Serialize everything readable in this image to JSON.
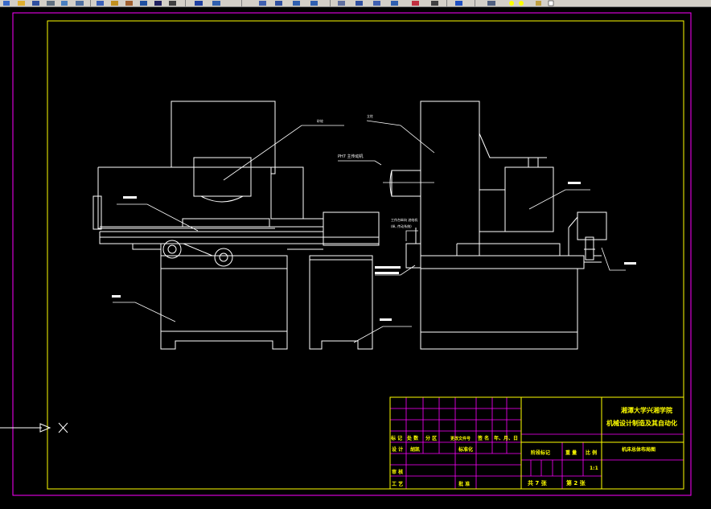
{
  "toolbar": {
    "icons": [
      "new-icon",
      "open-icon",
      "save-icon",
      "print-icon",
      "cut-icon",
      "copy-icon",
      "paste-icon",
      "match-icon",
      "undo-icon",
      "redo-icon",
      "pan-icon",
      "zoom-realtime-icon",
      "zoom-window-icon",
      "zoom-previous-icon",
      "properties-icon",
      "designcenter-icon",
      "toolpalette-icon",
      "sheetset-icon",
      "markup-icon",
      "calculator-icon",
      "help-icon",
      "layer-icon",
      "layer-state-icon"
    ],
    "bulb_color": "#ffff00",
    "layer_color": "#ffffff"
  },
  "drawing": {
    "background": "#000000",
    "frame_color": "#ff00ff",
    "border_color": "#ffff00",
    "line_color": "#ffffff",
    "labels": {
      "grinding_head": "砂轮",
      "column": "立柱",
      "ph7": "PH7 主传动机",
      "worktable_feed": "工作台纵向 进给机",
      "worktable_feed_line2": "(纵, 传动系统)"
    }
  },
  "title_block": {
    "school_line1": "湘潭大学兴湘学院",
    "school_line2": "机械设计制造及其自动化",
    "drawing_name": "机床总体布局图",
    "scale": "1:1",
    "scale_header": "比 例",
    "weight_header": "重 量",
    "stage_header": "阶段标记",
    "sheets_total": "共 7 张",
    "sheet_no": "第 2 张",
    "row_labels": {
      "mark": "标 记",
      "count": "处 数",
      "zone": "分 区",
      "change_doc": "更改文件号",
      "signature": "签 名",
      "date": "年、月、日",
      "design": "设 计",
      "design_name": "胡凯",
      "standardize": "标准化",
      "review": "审 核",
      "process": "工 艺",
      "approve": "批 准"
    }
  },
  "ucs": {
    "x_label": "X"
  }
}
